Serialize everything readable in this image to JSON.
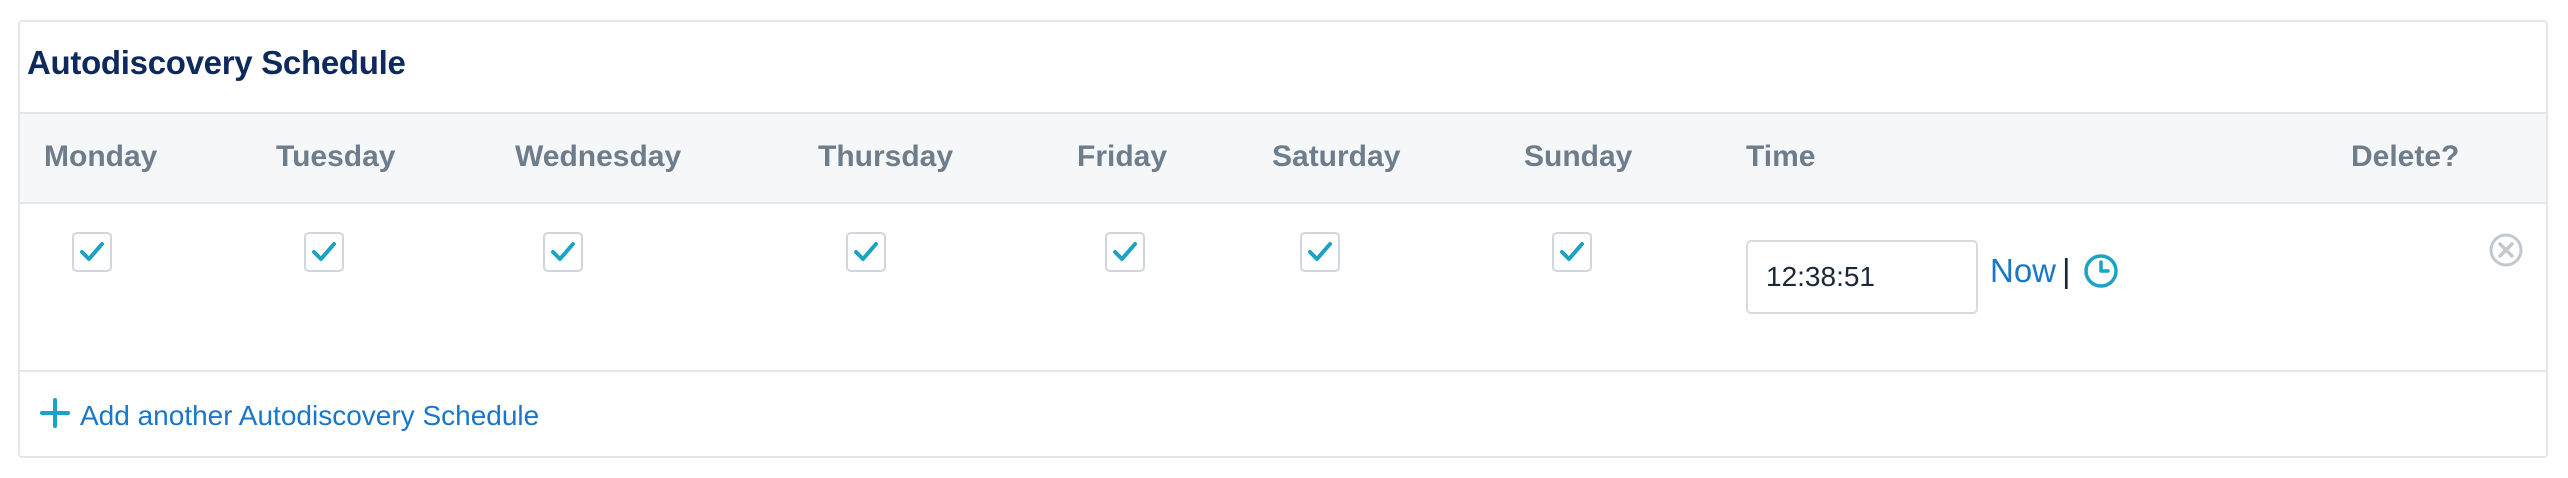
{
  "panel": {
    "title": "Autodiscovery Schedule"
  },
  "columns": {
    "monday": "Monday",
    "tuesday": "Tuesday",
    "wednesday": "Wednesday",
    "thursday": "Thursday",
    "friday": "Friday",
    "saturday": "Saturday",
    "sunday": "Sunday",
    "time": "Time",
    "delete": "Delete?"
  },
  "schedule_row": {
    "days_checked": {
      "monday": true,
      "tuesday": true,
      "wednesday": true,
      "thursday": true,
      "friday": true,
      "saturday": true,
      "sunday": true
    },
    "time_value": "12:38:51",
    "now_label": "Now",
    "separator": "|"
  },
  "add_link": {
    "label": "Add another Autodiscovery Schedule"
  },
  "colors": {
    "title": "#0e2a5c",
    "header_text": "#6e7d8c",
    "check": "#1aa3c2",
    "link": "#1877c9",
    "delete_icon": "#c3c8ce"
  },
  "icons": [
    "checkmark-icon",
    "clock-icon",
    "close-circle-icon",
    "plus-icon"
  ]
}
